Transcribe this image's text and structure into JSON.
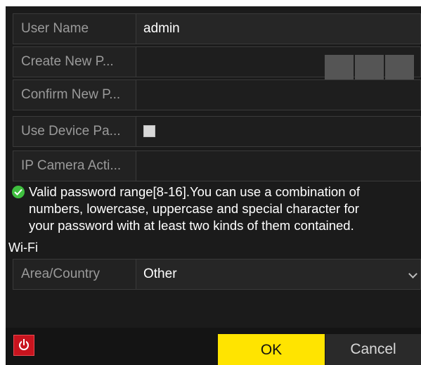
{
  "form": {
    "user_name": {
      "label": "User Name",
      "value": "admin"
    },
    "create_password": {
      "label": "Create New P...",
      "value": ""
    },
    "confirm_password": {
      "label": "Confirm New P...",
      "value": ""
    },
    "use_device_password": {
      "label": "Use Device Pa...",
      "checked": false
    },
    "ip_camera_activation": {
      "label": "IP Camera Acti...",
      "value": ""
    }
  },
  "hint": {
    "icon": "check-circle-icon",
    "lines": [
      "Valid password range[8-16].You can use a combination of",
      "numbers, lowercase, uppercase and special character for",
      "your password with at least two kinds of them contained."
    ]
  },
  "wifi": {
    "section_title": "Wi-Fi",
    "area_country": {
      "label": "Area/Country",
      "value": "Other"
    }
  },
  "footer": {
    "power_icon": "power-icon",
    "ok_label": "OK",
    "cancel_label": "Cancel"
  },
  "colors": {
    "accent": "#ffe400",
    "background": "#1b1b1b",
    "power": "#c8141e",
    "valid": "#3fbf3f"
  }
}
